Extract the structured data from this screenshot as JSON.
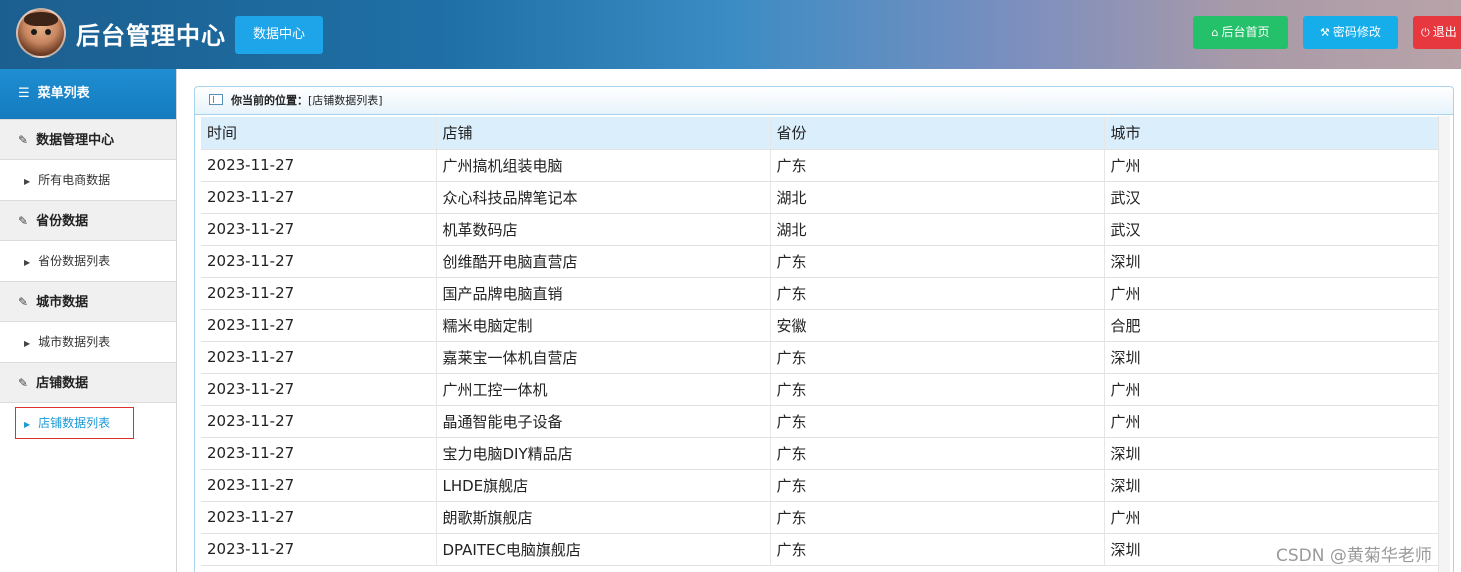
{
  "header": {
    "title": "后台管理中心",
    "data_center_label": "数据中心",
    "home_label": "后台首页",
    "password_label": "密码修改",
    "exit_label": "退出"
  },
  "sidebar": {
    "heading": "菜单列表",
    "groups": [
      {
        "label": "数据管理中心",
        "items": [
          {
            "label": "所有电商数据"
          }
        ]
      },
      {
        "label": "省份数据",
        "items": [
          {
            "label": "省份数据列表"
          }
        ]
      },
      {
        "label": "城市数据",
        "items": [
          {
            "label": "城市数据列表"
          }
        ]
      },
      {
        "label": "店铺数据",
        "items": [
          {
            "label": "店铺数据列表"
          }
        ]
      }
    ]
  },
  "breadcrumb": {
    "prefix": "你当前的位置：",
    "location": "[店铺数据列表]"
  },
  "table": {
    "columns": [
      "时间",
      "店铺",
      "省份",
      "城市"
    ],
    "rows": [
      [
        "2023-11-27",
        "广州搞机组装电脑",
        "广东",
        "广州"
      ],
      [
        "2023-11-27",
        "众心科技品牌笔记本",
        "湖北",
        "武汉"
      ],
      [
        "2023-11-27",
        "机革数码店",
        "湖北",
        "武汉"
      ],
      [
        "2023-11-27",
        "创维酷开电脑直营店",
        "广东",
        "深圳"
      ],
      [
        "2023-11-27",
        "国产品牌电脑直销",
        "广东",
        "广州"
      ],
      [
        "2023-11-27",
        "糯米电脑定制",
        "安徽",
        "合肥"
      ],
      [
        "2023-11-27",
        "嘉莱宝一体机自营店",
        "广东",
        "深圳"
      ],
      [
        "2023-11-27",
        "广州工控一体机",
        "广东",
        "广州"
      ],
      [
        "2023-11-27",
        "晶通智能电子设备",
        "广东",
        "广州"
      ],
      [
        "2023-11-27",
        "宝力电脑DIY精品店",
        "广东",
        "深圳"
      ],
      [
        "2023-11-27",
        "LHDE旗舰店",
        "广东",
        "深圳"
      ],
      [
        "2023-11-27",
        "朗歌斯旗舰店",
        "广东",
        "广州"
      ],
      [
        "2023-11-27",
        "DPAITEC电脑旗舰店",
        "广东",
        "深圳"
      ]
    ]
  },
  "watermark": "CSDN @黄菊华老师",
  "colors": {
    "accent": "#1ea4e9",
    "home_button": "#24c06a",
    "exit_button": "#e8383f",
    "active_menu_text": "#1a9ad6",
    "table_header_bg": "#dbeefb"
  },
  "icons": {
    "home": "home-icon",
    "password": "wrench-icon",
    "exit": "power-icon",
    "menu": "list-icon",
    "group": "edit-icon",
    "item": "caret-right-icon",
    "breadcrumb": "window-icon"
  }
}
